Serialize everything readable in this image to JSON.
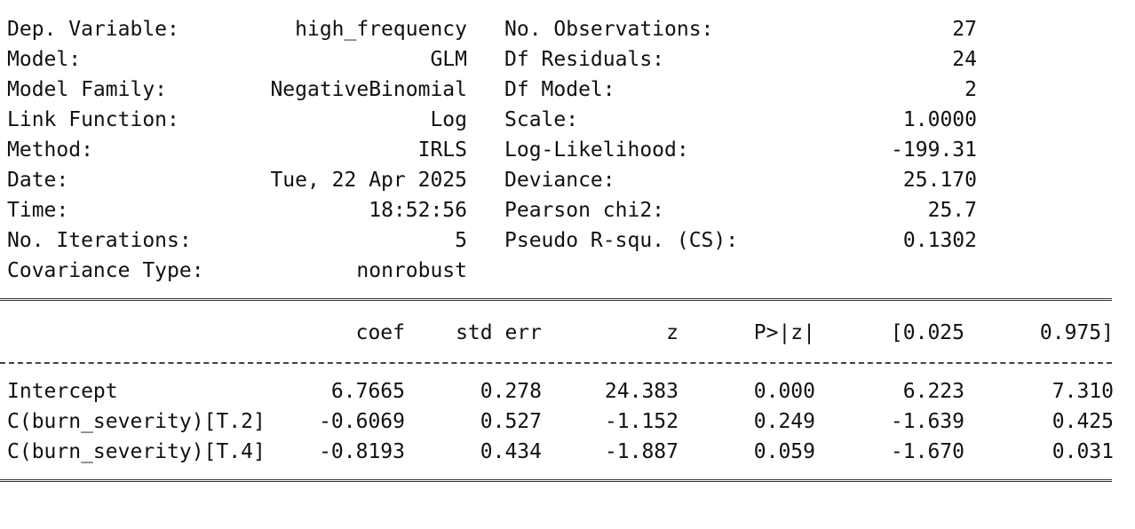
{
  "summary": {
    "left": [
      {
        "label": "Dep. Variable:",
        "value": "high_frequency"
      },
      {
        "label": "Model:",
        "value": "GLM"
      },
      {
        "label": "Model Family:",
        "value": "NegativeBinomial"
      },
      {
        "label": "Link Function:",
        "value": "Log"
      },
      {
        "label": "Method:",
        "value": "IRLS"
      },
      {
        "label": "Date:",
        "value": "Tue, 22 Apr 2025"
      },
      {
        "label": "Time:",
        "value": "18:52:56"
      },
      {
        "label": "No. Iterations:",
        "value": "5"
      },
      {
        "label": "Covariance Type:",
        "value": "nonrobust"
      }
    ],
    "right": [
      {
        "label": "No. Observations:",
        "value": "27"
      },
      {
        "label": "Df Residuals:",
        "value": "24"
      },
      {
        "label": "Df Model:",
        "value": "2"
      },
      {
        "label": "Scale:",
        "value": "1.0000"
      },
      {
        "label": "Log-Likelihood:",
        "value": "-199.31"
      },
      {
        "label": "Deviance:",
        "value": "25.170"
      },
      {
        "label": "Pearson chi2:",
        "value": "25.7"
      },
      {
        "label": "Pseudo R-squ. (CS):",
        "value": "0.1302"
      }
    ]
  },
  "coef_table": {
    "headers": [
      "coef",
      "std err",
      "z",
      "P>|z|",
      "[0.025",
      "0.975]"
    ],
    "rows": [
      {
        "name": "Intercept",
        "values": [
          "6.7665",
          "0.278",
          "24.383",
          "0.000",
          "6.223",
          "7.310"
        ]
      },
      {
        "name": "C(burn_severity)[T.2]",
        "values": [
          "-0.6069",
          "0.527",
          "-1.152",
          "0.249",
          "-1.639",
          "0.425"
        ]
      },
      {
        "name": "C(burn_severity)[T.4]",
        "values": [
          "-0.8193",
          "0.434",
          "-1.887",
          "0.059",
          "-1.670",
          "0.031"
        ]
      }
    ]
  }
}
